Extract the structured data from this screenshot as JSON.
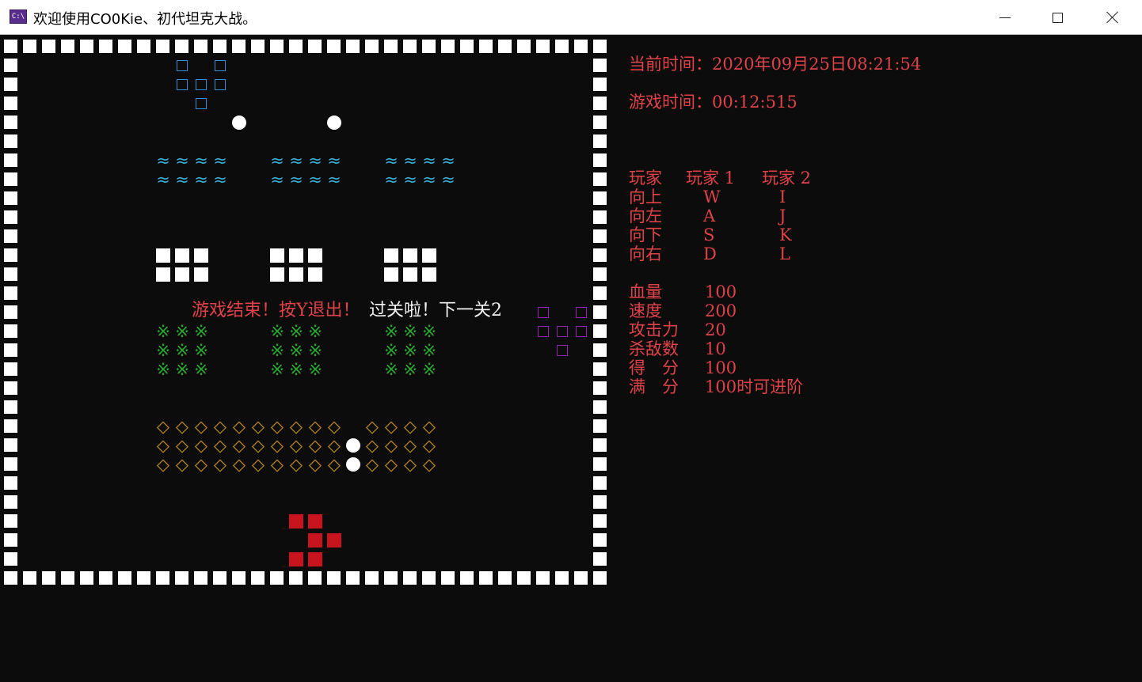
{
  "window": {
    "title": "欢迎使用CO0Kie、初代坦克大战。",
    "icon": "console-icon",
    "controls": [
      "minimize-button",
      "maximize-button",
      "close-button"
    ]
  },
  "colors": {
    "background": "#0c0c0c",
    "wall": "#ffffff",
    "red_text": "#e0424a",
    "water": "#3aa9c8",
    "grass": "#2aa832",
    "gold": "#c8901e",
    "blue_tank": "#3a8ed0",
    "purple_tank": "#8a2aa8",
    "red_tank": "#c8141e"
  },
  "game": {
    "message_over": "游戏结束！按Y退出！",
    "message_next": "过关啦！下一关2",
    "water_glyph": "≈",
    "grass_glyph": "※",
    "gold_glyph": "◇"
  },
  "info": {
    "current_time_label": "当前时间：",
    "current_time": "2020年09月25日08:21:54",
    "game_time_label": "游戏时间：",
    "game_time": "00:12:515",
    "keys_header": [
      "玩家",
      "玩家 1",
      "玩家 2"
    ],
    "keys": [
      {
        "label": "向上",
        "p1": "W",
        "p2": "I"
      },
      {
        "label": "向左",
        "p1": "A",
        "p2": "J"
      },
      {
        "label": "向下",
        "p1": "S",
        "p2": "K"
      },
      {
        "label": "向右",
        "p1": "D",
        "p2": "L"
      }
    ],
    "stats": [
      {
        "label": "血量",
        "value": "100"
      },
      {
        "label": "速度",
        "value": "200"
      },
      {
        "label": "攻击力",
        "value": "20"
      },
      {
        "label": "杀敌数",
        "value": "10"
      },
      {
        "label": "得　分",
        "value": "100"
      },
      {
        "label": "满　分",
        "value": "100时可进阶"
      }
    ]
  }
}
